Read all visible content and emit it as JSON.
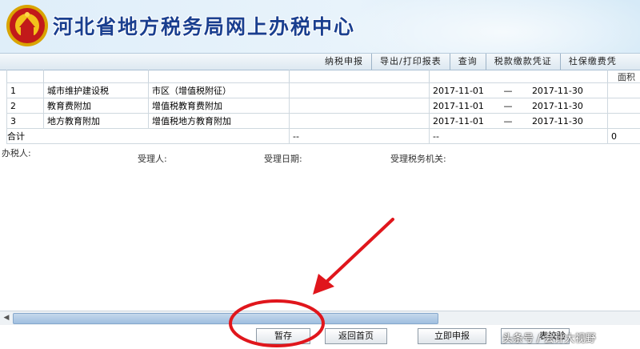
{
  "header": {
    "title": "河北省地方税务局网上办税中心"
  },
  "nav": {
    "items": [
      "纳税申报",
      "导出/打印报表",
      "查询",
      "税款缴款凭证",
      "社保缴费凭"
    ]
  },
  "subhead": {
    "area_label": "面积"
  },
  "rows": [
    {
      "index": "1",
      "tax": "城市维护建设税",
      "item": "市区（增值税附征）",
      "start": "2017-11-01",
      "dash": "—",
      "end": "2017-11-30"
    },
    {
      "index": "2",
      "tax": "教育费附加",
      "item": "增值税教育费附加",
      "start": "2017-11-01",
      "dash": "—",
      "end": "2017-11-30"
    },
    {
      "index": "3",
      "tax": "地方教育附加",
      "item": "增值税地方教育附加",
      "start": "2017-11-01",
      "dash": "—",
      "end": "2017-11-30"
    }
  ],
  "total": {
    "label": "合计",
    "c1": "--",
    "c2": "--",
    "c3": "0"
  },
  "signature": {
    "taxpayer": "办税人:",
    "receiver": "受理人:",
    "date": "受理日期:",
    "office": "受理税务机关:"
  },
  "buttons": {
    "save": "暂存",
    "home": "返回首页",
    "submit": "立即申报",
    "check": "表校验"
  },
  "watermark": "头条号 / 会计大视野",
  "colors": {
    "title": "#1a3f8f",
    "annotation": "#e0161c",
    "scroll_thumb": "#9fbfe0"
  }
}
